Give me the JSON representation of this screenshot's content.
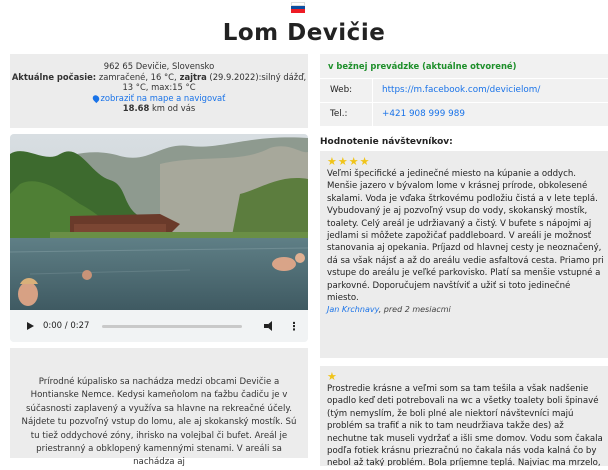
{
  "page": {
    "title": "Lom Devičie",
    "flag": "slovakia-flag"
  },
  "info": {
    "address": "962 65 Devičie, Slovensko",
    "weather_label": "Aktuálne počasie:",
    "weather_now": " zamračené, 16 °C,",
    "tomorrow_label": " zajtra",
    "weather_tomorrow": " (29.9.2022):silný dážď, 13 °C, max:15 °C",
    "map_link": "zobraziť na mape a navigovať",
    "distance": "18.68",
    "distance_suffix": " km od vás"
  },
  "video": {
    "time": "0:00 / 0:27",
    "progress": 0.0
  },
  "description": "Prírodné kúpalisko sa nachádza medzi obcami Devičie a Hontianske Nemce. Kedysi kameňolom na ťažbu čadiču je v súčasnosti zaplavený a využíva sa hlavne na rekreačné účely. Nájdete tu pozvoľný vstup do lomu, ale aj skokanský mostík. Sú tu tiež oddychové zóny, ihrisko na volejbal či bufet. Areál je priestranný a obklopený kamennými stenami. V areáli sa nachádza aj",
  "status": "v bežnej prevádzke (aktuálne otvorené)",
  "contacts": {
    "web_label": "Web:",
    "web": "https://m.facebook.com/devicielom/",
    "tel_label": "Tel.:",
    "tel": "+421 908 999 989"
  },
  "reviews_heading": "Hodnotenie návštevníkov:",
  "reviews": [
    {
      "stars": "★★★★",
      "rating": 4,
      "text": "Veľmi špecifické a jedinečné miesto na kúpanie a oddych. Menšie jazero v bývalom lome v krásnej prírode, obkolesené skalami. Voda je vďaka štrkovému podložiu čistá a v lete teplá. Vybudovaný je aj pozvoľný vsup do vody, skokanský mostík, toalety. Celý areál je udržiavaný a čistý. V bufete s nápojmi aj jedlami si môžete zapožičať paddleboard. V areáli je možnosť stanovania aj opekania. Príjazd od hlavnej cesty je neoznačený, dá sa však nájsť a až do areálu vedie asfaltová cesta. Priamo pri vstupe do areálu je veľké parkovisko. Platí sa menšie vstupné a parkovné. Doporučujem navštíviť a užiť si toto jedinečné miesto.",
      "author": "Jan Krchnavy",
      "ago": ", pred 2 mesiacmi"
    },
    {
      "stars": "★",
      "rating": 1,
      "text": "Prostredie krásne a veľmi som sa tam tešila a však nadšenie opadlo keď deti potrebovali na wc a všetky toalety boli špinavé (tým nemyslím, že boli plné ale niektorí návštevníci majú problém sa trafiť a nik to tam neudržiava takže des) až nechutne tak museli vydržať a išli sme domov. Vodu som čakala podľa fotiek krásnu priezračnú no čakala nás voda kalná čo by nebol až taký problém. Bola príjemne teplá. Najviac ma mrzelo, že sme"
    }
  ],
  "colors": {
    "accent": "#1a73e8",
    "open": "#1e8f2b",
    "star": "#f0c419",
    "panel": "#ececec"
  }
}
